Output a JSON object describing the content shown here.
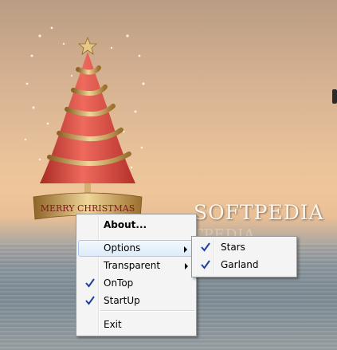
{
  "desktop": {
    "watermark": "SOFTPEDIA",
    "watermark_ghost": "SOFTPEDIA",
    "greeting": "MERRY CHRISTMAS"
  },
  "context_menu": {
    "items": [
      {
        "label": "About...",
        "bold": true
      },
      {
        "label": "Options",
        "has_submenu": true,
        "highlighted": true
      },
      {
        "label": "Transparent",
        "has_submenu": true
      },
      {
        "label": "OnTop",
        "checked": true
      },
      {
        "label": "StartUp",
        "checked": true
      },
      {
        "label": "Exit"
      }
    ]
  },
  "options_submenu": {
    "items": [
      {
        "label": "Stars",
        "checked": true
      },
      {
        "label": "Garland",
        "checked": true
      }
    ]
  },
  "colors": {
    "highlight": "#dcebfb",
    "check": "#1f3f9c",
    "tree_red": "#d8463b",
    "ribbon_gold": "#c89a4e"
  },
  "icons": [
    "check-icon",
    "submenu-arrow-icon",
    "star-icon",
    "christmas-tree-icon"
  ]
}
